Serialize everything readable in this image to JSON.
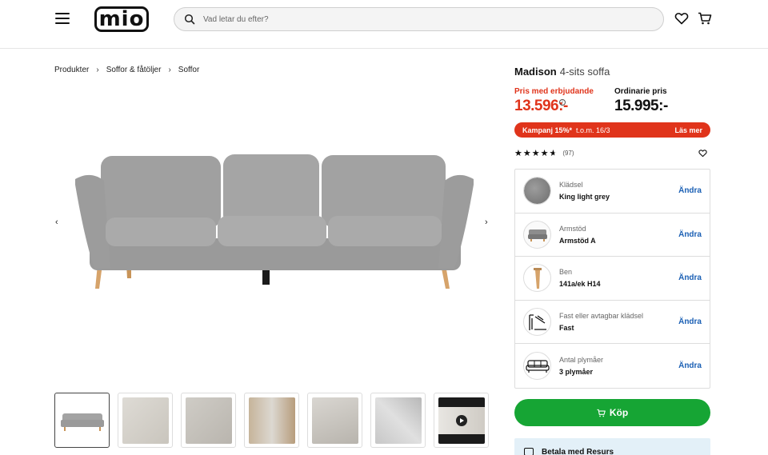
{
  "header": {
    "logo_text": "mio",
    "search_placeholder": "Vad letar du efter?"
  },
  "breadcrumb": [
    {
      "label": "Produkter"
    },
    {
      "label": "Soffor & fåtöljer"
    },
    {
      "label": "Soffor"
    }
  ],
  "product": {
    "name": "Madison",
    "subtitle": "4-sits soffa",
    "offer_label": "Pris med erbjudande",
    "offer_price": "13.596:-",
    "regular_label": "Ordinarie pris",
    "regular_price": "15.995:-",
    "campaign_bold": "Kampanj 15%*",
    "campaign_text": "t.o.m. 16/3",
    "campaign_link": "Läs mer",
    "stars": "★★★★★",
    "rating": 4.5,
    "review_count": "(97)",
    "options": [
      {
        "label": "Klädsel",
        "value": "King light grey",
        "action": "Ändra",
        "icon": "fabric-swatch-icon"
      },
      {
        "label": "Armstöd",
        "value": "Armstöd A",
        "action": "Ändra",
        "icon": "armrest-icon"
      },
      {
        "label": "Ben",
        "value": "141a/ek H14",
        "action": "Ändra",
        "icon": "leg-icon"
      },
      {
        "label": "Fast eller avtagbar klädsel",
        "value": "Fast",
        "action": "Ändra",
        "icon": "upholstery-icon"
      },
      {
        "label": "Antal plymåer",
        "value": "3 plymåer",
        "action": "Ändra",
        "icon": "cushions-icon"
      }
    ],
    "buy_label": "Köp",
    "payment_label": "Betala med Resurs"
  },
  "colors": {
    "accent_red": "#e0341b",
    "buy_green": "#16a534",
    "link_blue": "#1a5fb4",
    "sofa_grey": "#a3a3a3"
  }
}
